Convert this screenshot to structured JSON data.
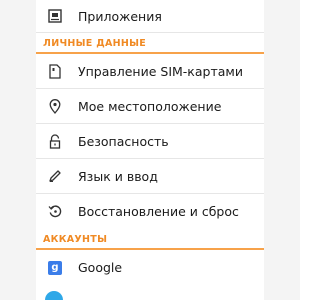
{
  "apps_item": {
    "label": "Приложения",
    "icon": "apps-icon"
  },
  "sections": {
    "personal": "ЛИЧНЫЕ ДАННЫЕ",
    "accounts": "АККАУНТЫ"
  },
  "personal_items": [
    {
      "label": "Управление SIM-картами",
      "icon": "sim-card-icon"
    },
    {
      "label": "Мое местоположение",
      "icon": "location-pin-icon"
    },
    {
      "label": "Безопасность",
      "icon": "lock-icon"
    },
    {
      "label": "Язык и ввод",
      "icon": "pencil-icon"
    },
    {
      "label": "Восстановление и сброс",
      "icon": "restore-icon"
    }
  ],
  "accounts_items": [
    {
      "label": "Google",
      "icon": "google-icon",
      "icon_glyph": "g"
    }
  ],
  "colors": {
    "accent": "#f08a24",
    "divider": "#f7a24a",
    "google_blue": "#3b7de9"
  }
}
